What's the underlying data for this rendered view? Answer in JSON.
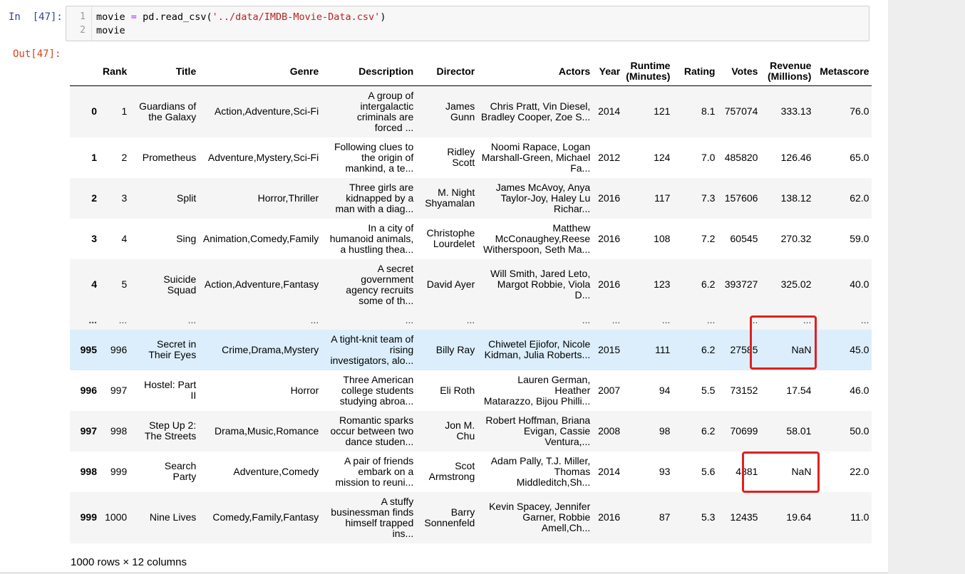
{
  "prompts": {
    "in": "In  [47]:",
    "out": "Out[47]:"
  },
  "code": {
    "line_numbers": [
      "1",
      "2"
    ],
    "line1": {
      "var": "movie",
      "op": "=",
      "call": "pd.read_csv(",
      "arg": "'../data/IMDB-Movie-Data.csv'",
      "close": ")"
    },
    "line2": "movie"
  },
  "table": {
    "columns": [
      "",
      "Rank",
      "Title",
      "Genre",
      "Description",
      "Director",
      "Actors",
      "Year",
      "Runtime\n(Minutes)",
      "Rating",
      "Votes",
      "Revenue\n(Millions)",
      "Metascore"
    ],
    "rows": [
      [
        "0",
        "1",
        "Guardians of\nthe Galaxy",
        "Action,Adventure,Sci-Fi",
        "A group of\nintergalactic\ncriminals are\nforced ...",
        "James\nGunn",
        "Chris Pratt, Vin Diesel,\nBradley Cooper, Zoe S...",
        "2014",
        "121",
        "8.1",
        "757074",
        "333.13",
        "76.0"
      ],
      [
        "1",
        "2",
        "Prometheus",
        "Adventure,Mystery,Sci-Fi",
        "Following clues to\nthe origin of\nmankind, a te...",
        "Ridley\nScott",
        "Noomi Rapace, Logan\nMarshall-Green, Michael\nFa...",
        "2012",
        "124",
        "7.0",
        "485820",
        "126.46",
        "65.0"
      ],
      [
        "2",
        "3",
        "Split",
        "Horror,Thriller",
        "Three girls are\nkidnapped by a\nman with a diag...",
        "M. Night\nShyamalan",
        "James McAvoy, Anya\nTaylor-Joy, Haley Lu\nRichar...",
        "2016",
        "117",
        "7.3",
        "157606",
        "138.12",
        "62.0"
      ],
      [
        "3",
        "4",
        "Sing",
        "Animation,Comedy,Family",
        "In a city of\nhumanoid animals,\na hustling thea...",
        "Christophe\nLourdelet",
        "Matthew\nMcConaughey,Reese\nWitherspoon, Seth Ma...",
        "2016",
        "108",
        "7.2",
        "60545",
        "270.32",
        "59.0"
      ],
      [
        "4",
        "5",
        "Suicide\nSquad",
        "Action,Adventure,Fantasy",
        "A secret\ngovernment\nagency recruits\nsome of th...",
        "David Ayer",
        "Will Smith, Jared Leto,\nMargot Robbie, Viola\nD...",
        "2016",
        "123",
        "6.2",
        "393727",
        "325.02",
        "40.0"
      ],
      [
        "...",
        "...",
        "...",
        "...",
        "...",
        "...",
        "...",
        "...",
        "...",
        "...",
        "...",
        "...",
        "..."
      ],
      [
        "995",
        "996",
        "Secret in\nTheir Eyes",
        "Crime,Drama,Mystery",
        "A tight-knit team of\nrising\ninvestigators, alo...",
        "Billy Ray",
        "Chiwetel Ejiofor, Nicole\nKidman, Julia Roberts...",
        "2015",
        "111",
        "6.2",
        "27585",
        "NaN",
        "45.0"
      ],
      [
        "996",
        "997",
        "Hostel: Part\nII",
        "Horror",
        "Three American\ncollege students\nstudying abroa...",
        "Eli Roth",
        "Lauren German, Heather\nMatarazzo, Bijou Philli...",
        "2007",
        "94",
        "5.5",
        "73152",
        "17.54",
        "46.0"
      ],
      [
        "997",
        "998",
        "Step Up 2:\nThe Streets",
        "Drama,Music,Romance",
        "Romantic sparks\noccur between two\ndance studen...",
        "Jon M.\nChu",
        "Robert Hoffman, Briana\nEvigan, Cassie\nVentura,...",
        "2008",
        "98",
        "6.2",
        "70699",
        "58.01",
        "50.0"
      ],
      [
        "998",
        "999",
        "Search\nParty",
        "Adventure,Comedy",
        "A pair of friends\nembark on a\nmission to reuni...",
        "Scot\nArmstrong",
        "Adam Pally, T.J. Miller,\nThomas\nMiddleditch,Sh...",
        "2014",
        "93",
        "5.6",
        "4881",
        "NaN",
        "22.0"
      ],
      [
        "999",
        "1000",
        "Nine Lives",
        "Comedy,Family,Fantasy",
        "A stuffy\nbusinessman finds\nhimself trapped\nins...",
        "Barry\nSonnenfeld",
        "Kevin Spacey, Jennifer\nGarner, Robbie\nAmell,Ch...",
        "2016",
        "87",
        "5.3",
        "12435",
        "19.64",
        "11.0"
      ]
    ]
  },
  "footer": "1000 rows × 12 columns",
  "colors": {
    "in_prompt": "#303f9f",
    "out_prompt": "#d84315",
    "highlight_row": "#dceefb",
    "annotation_box": "#e0201e"
  }
}
